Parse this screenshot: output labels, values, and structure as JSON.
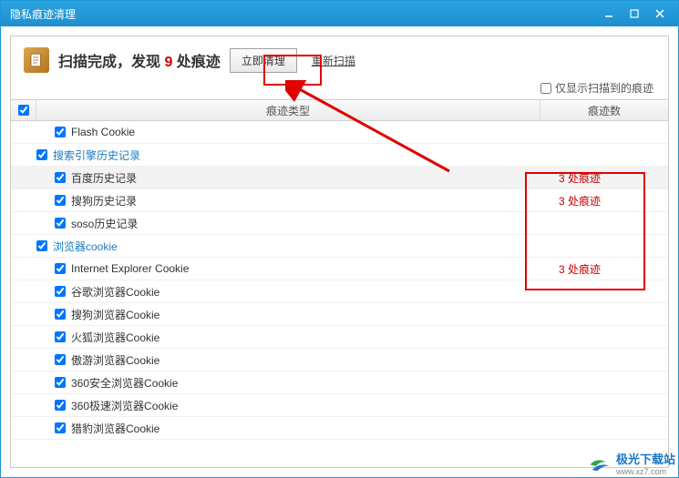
{
  "window": {
    "title": "隐私痕迹清理"
  },
  "header": {
    "scan_prefix": "扫描完成，发现 ",
    "scan_count": "9",
    "scan_suffix": " 处痕迹",
    "clean_btn": "立即清理",
    "rescan_link": "重新扫描"
  },
  "option": {
    "only_found_label": "仅显示扫描到的痕迹"
  },
  "columns": {
    "type": "痕迹类型",
    "count": "痕迹数"
  },
  "rows": [
    {
      "kind": "item",
      "checked": true,
      "label": "Flash Cookie",
      "count": "",
      "sel": false
    },
    {
      "kind": "group",
      "checked": true,
      "label": "搜索引擎历史记录",
      "count": "",
      "sel": false
    },
    {
      "kind": "item",
      "checked": true,
      "label": "百度历史记录",
      "count": "3 处痕迹",
      "sel": true
    },
    {
      "kind": "item",
      "checked": true,
      "label": "搜狗历史记录",
      "count": "3 处痕迹",
      "sel": false
    },
    {
      "kind": "item",
      "checked": true,
      "label": "soso历史记录",
      "count": "",
      "sel": false
    },
    {
      "kind": "group",
      "checked": true,
      "label": "浏览器cookie",
      "count": "",
      "sel": false
    },
    {
      "kind": "item",
      "checked": true,
      "label": "Internet Explorer Cookie",
      "count": "3 处痕迹",
      "sel": false
    },
    {
      "kind": "item",
      "checked": true,
      "label": "谷歌浏览器Cookie",
      "count": "",
      "sel": false
    },
    {
      "kind": "item",
      "checked": true,
      "label": "搜狗浏览器Cookie",
      "count": "",
      "sel": false
    },
    {
      "kind": "item",
      "checked": true,
      "label": "火狐浏览器Cookie",
      "count": "",
      "sel": false
    },
    {
      "kind": "item",
      "checked": true,
      "label": "傲游浏览器Cookie",
      "count": "",
      "sel": false
    },
    {
      "kind": "item",
      "checked": true,
      "label": "360安全浏览器Cookie",
      "count": "",
      "sel": false
    },
    {
      "kind": "item",
      "checked": true,
      "label": "360极速浏览器Cookie",
      "count": "",
      "sel": false
    },
    {
      "kind": "item",
      "checked": true,
      "label": "猎豹浏览器Cookie",
      "count": "",
      "sel": false
    }
  ],
  "watermark": {
    "name": "极光下载站",
    "url": "www.xz7.com"
  }
}
